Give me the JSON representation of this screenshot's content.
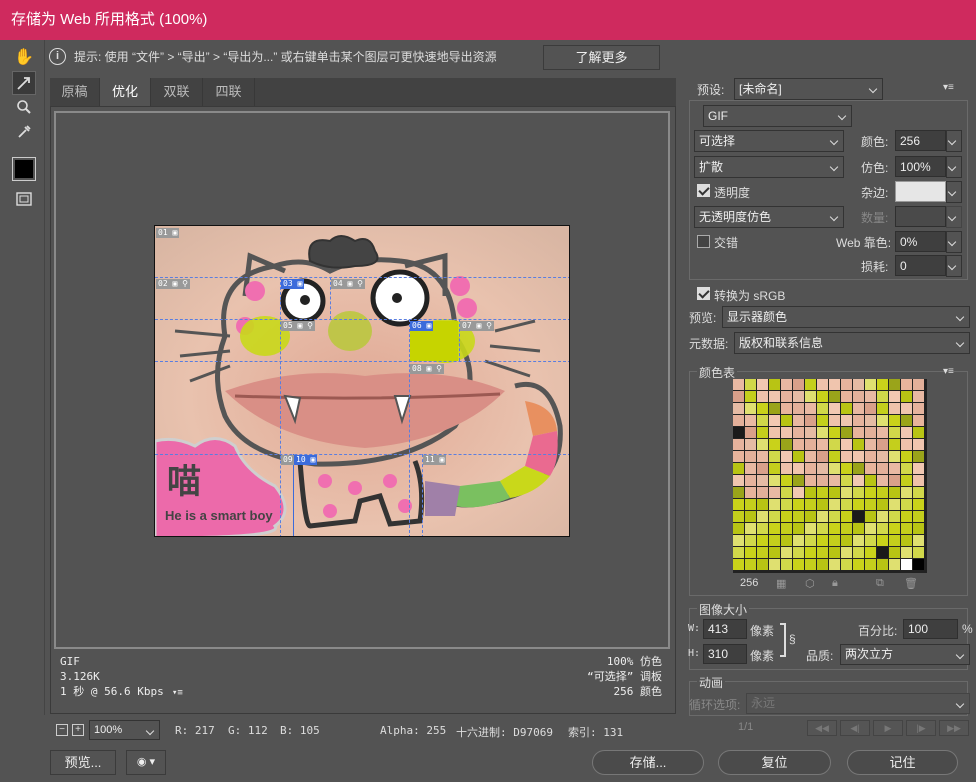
{
  "window": {
    "title": "存储为 Web 所用格式 (100%)"
  },
  "hint": {
    "text": "提示: 使用 “文件” > “导出” > “导出为...” 或右键单击某个图层可更快速地导出资源",
    "learn_more": "了解更多"
  },
  "tabs": [
    "原稿",
    "优化",
    "双联",
    "四联"
  ],
  "active_tab": "优化",
  "image": {
    "caption_cjk": "喵",
    "caption_en": "He is a smart boy",
    "slices": [
      "01",
      "02",
      "03",
      "04",
      "05",
      "06",
      "07",
      "08",
      "09",
      "10",
      "11"
    ]
  },
  "status": {
    "format": "GIF",
    "size": "3.126K",
    "time": "1 秒 @ 56.6 Kbps",
    "dither": "100% 仿色",
    "palette": "“可选择” 调板",
    "colors": "256 颜色"
  },
  "bottom": {
    "zoom": "100%",
    "r": "R: 217",
    "g": "G: 112",
    "b": "B: 105",
    "alpha": "Alpha: 255",
    "hex": "十六进制: D97069",
    "index": "索引: 131"
  },
  "buttons": {
    "preview": "预览...",
    "save": "存储...",
    "reset": "复位",
    "remember": "记住"
  },
  "settings": {
    "preset_label": "预设:",
    "preset_value": "[未命名]",
    "format": "GIF",
    "reduction": "可选择",
    "colors_label": "颜色:",
    "colors_value": "256",
    "dither_algo": "扩散",
    "dither_label": "仿色:",
    "dither_value": "100%",
    "transparency": "透明度",
    "matte_label": "杂边:",
    "trans_dither": "无透明度仿色",
    "amount_label": "数量:",
    "interlaced": "交错",
    "websnap_label": "Web 靠色:",
    "websnap_value": "0%",
    "lossy_label": "损耗:",
    "lossy_value": "0",
    "convert_srgb": "转换为 sRGB",
    "preview_label": "预览:",
    "preview_value": "显示器颜色",
    "metadata_label": "元数据:",
    "metadata_value": "版权和联系信息"
  },
  "color_table": {
    "title": "颜色表",
    "count": "256",
    "colors": [
      "#e9b9a3",
      "#efc2ab",
      "#e8b49c",
      "#d9a08a",
      "#c9d21a",
      "#b8c414",
      "#e5bba4",
      "#d1d84a",
      "#f0c5ae",
      "#e3b09a",
      "#c4cf1c",
      "#9aa41a",
      "#e8b8a2",
      "#dfe070",
      "#f2c8b2",
      "#e6b39d"
    ]
  },
  "image_size": {
    "title": "图像大小",
    "w_label": "W:",
    "w_value": "413",
    "h_label": "H:",
    "h_value": "310",
    "unit": "像素",
    "percent_label": "百分比:",
    "percent_value": "100",
    "percent_unit": "%",
    "quality_label": "品质:",
    "quality_value": "两次立方"
  },
  "animation": {
    "title": "动画",
    "loop_label": "循环选项:",
    "loop_value": "永远",
    "frame": "1/1"
  }
}
